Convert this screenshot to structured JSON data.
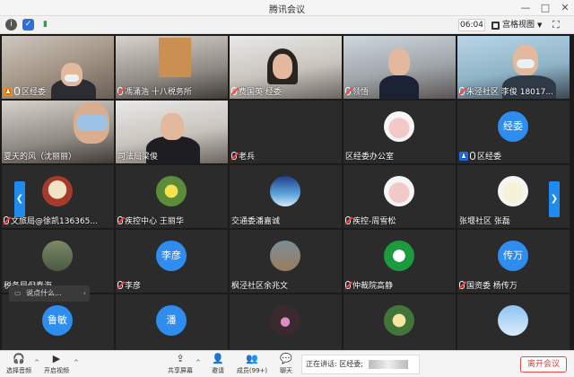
{
  "window": {
    "title": "腾讯会议",
    "controls": [
      "—",
      "□",
      "✕"
    ]
  },
  "topbar": {
    "timer": "06:04",
    "view_label": "宫格视图"
  },
  "tiles": [
    {
      "label": "区经委",
      "kind": "video",
      "host": true
    },
    {
      "label": "馮涌浩 十八税务所",
      "kind": "video"
    },
    {
      "label": "费国英 经委",
      "kind": "video"
    },
    {
      "label": "领悟",
      "kind": "video"
    },
    {
      "label": "朱泾社区 李俊 18017...",
      "kind": "video"
    },
    {
      "label": "夏天的风（沈丽丽）",
      "kind": "video"
    },
    {
      "label": "司法局梁俊",
      "kind": "video"
    },
    {
      "label": "老兵",
      "kind": "blank"
    },
    {
      "label": "区经委办公室",
      "kind": "avatar"
    },
    {
      "label": "区经委",
      "kind": "avatar-text",
      "avatar_text": "经委"
    },
    {
      "label": "文旅局@徐凯136365...",
      "kind": "avatar"
    },
    {
      "label": "疾控中心 王丽华",
      "kind": "avatar"
    },
    {
      "label": "交通委潘嘉诚",
      "kind": "avatar"
    },
    {
      "label": "疾控-周雪松",
      "kind": "avatar"
    },
    {
      "label": "张堰社区 张磊",
      "kind": "avatar"
    },
    {
      "label": "税务局倪春海",
      "kind": "avatar"
    },
    {
      "label": "李彦",
      "kind": "avatar-text",
      "avatar_text": "李彦"
    },
    {
      "label": "枫泾社区余兆文",
      "kind": "avatar"
    },
    {
      "label": "仲裁院高静",
      "kind": "avatar"
    },
    {
      "label": "国资委 杨传万",
      "kind": "avatar-text",
      "avatar_text": "传万"
    },
    {
      "label": "",
      "kind": "avatar-text",
      "avatar_text": "鲁敏"
    },
    {
      "label": "",
      "kind": "avatar-text",
      "avatar_text": "潘"
    },
    {
      "label": "",
      "kind": "avatar"
    },
    {
      "label": "",
      "kind": "avatar"
    },
    {
      "label": "",
      "kind": "avatar"
    }
  ],
  "chat_popup": {
    "text": "说点什么..."
  },
  "bottombar": {
    "audio_label": "选择音频",
    "video_label": "开启视频",
    "share_label": "共享屏幕",
    "invite_label": "邀请",
    "members_label": "成员(99+)",
    "chat_label": "聊天",
    "speaking_text": "正在讲话: 区经委;",
    "leave_label": "离开会议"
  }
}
